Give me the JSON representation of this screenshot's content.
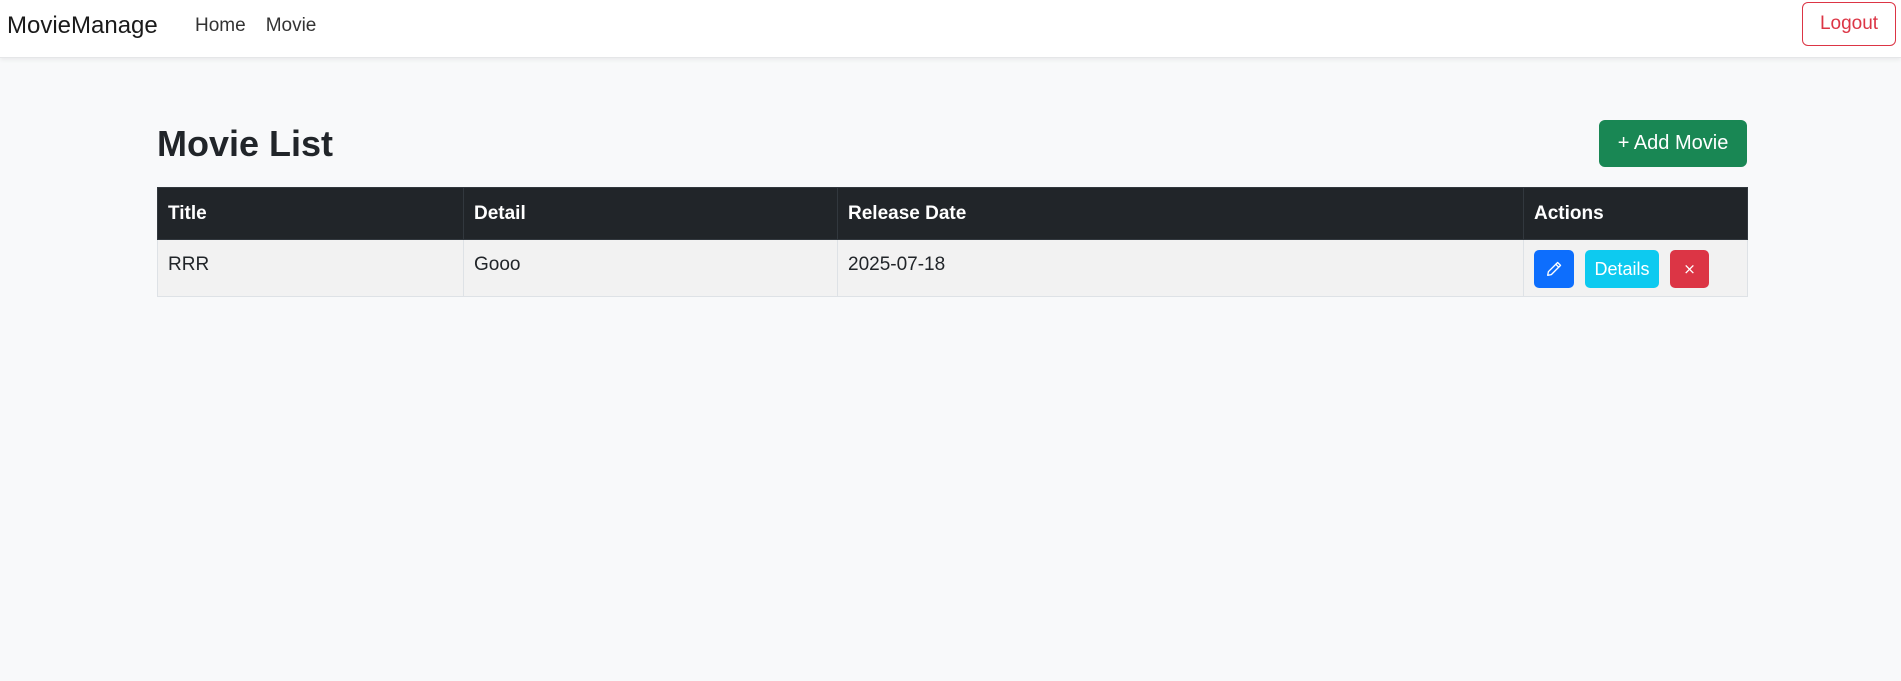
{
  "navbar": {
    "brand": "MovieManage",
    "links": [
      {
        "label": "Home"
      },
      {
        "label": "Movie"
      }
    ],
    "logout_label": "Logout"
  },
  "main": {
    "title": "Movie List",
    "add_button_label": "+ Add Movie",
    "table": {
      "headers": [
        "Title",
        "Detail",
        "Release Date",
        "Actions"
      ],
      "rows": [
        {
          "title": "RRR",
          "detail": "Gooo",
          "release_date": "2025-07-18",
          "actions": {
            "edit_icon": "pencil-icon",
            "details_label": "Details",
            "delete_label": "×"
          }
        }
      ]
    }
  },
  "colors": {
    "primary": "#0d6efd",
    "success": "#198754",
    "info": "#0dcaf0",
    "danger": "#dc3545",
    "dark": "#212529",
    "background": "#f8f9fa"
  }
}
